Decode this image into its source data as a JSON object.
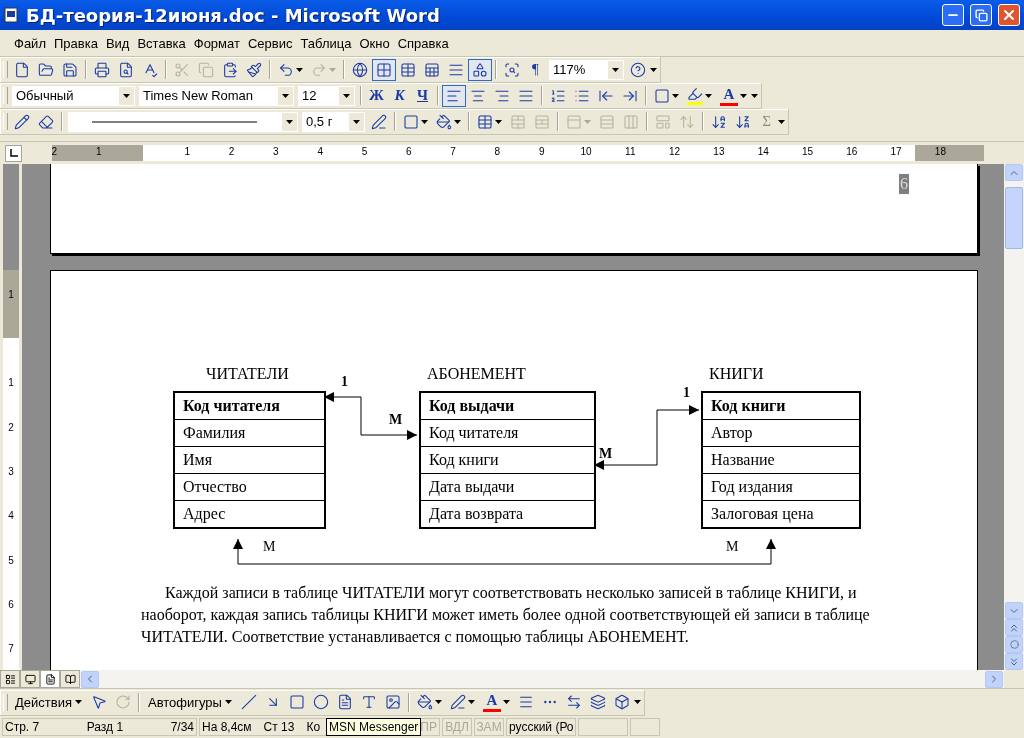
{
  "window": {
    "title": "БД-теория-12июня.doc - Microsoft Word"
  },
  "menu": [
    "Файл",
    "Правка",
    "Вид",
    "Вставка",
    "Формат",
    "Сервис",
    "Таблица",
    "Окно",
    "Справка"
  ],
  "standard_toolbar": [
    {
      "kind": "icon",
      "disabled": false,
      "pressed": false,
      "menu": false
    },
    {
      "kind": "icon",
      "disabled": false,
      "pressed": false,
      "menu": false
    },
    {
      "kind": "icon",
      "disabled": false,
      "pressed": false,
      "menu": false
    },
    {
      "kind": "separator"
    },
    {
      "kind": "icon",
      "disabled": false,
      "pressed": false,
      "menu": false
    },
    {
      "kind": "icon",
      "disabled": false,
      "pressed": false,
      "menu": false
    },
    {
      "kind": "icon",
      "disabled": false,
      "pressed": false,
      "menu": false
    },
    {
      "kind": "separator"
    },
    {
      "kind": "icon",
      "disabled": true,
      "pressed": false,
      "menu": false
    },
    {
      "kind": "icon",
      "disabled": true,
      "pressed": false,
      "menu": false
    },
    {
      "kind": "icon",
      "disabled": false,
      "pressed": false,
      "menu": false
    },
    {
      "kind": "icon",
      "disabled": false,
      "pressed": false,
      "menu": false
    },
    {
      "kind": "separator"
    },
    {
      "kind": "icon",
      "disabled": false,
      "pressed": false,
      "menu": true
    },
    {
      "kind": "icon",
      "disabled": true,
      "pressed": false,
      "menu": true
    },
    {
      "kind": "separator"
    },
    {
      "kind": "icon",
      "disabled": false,
      "pressed": false,
      "menu": false
    },
    {
      "kind": "icon",
      "disabled": false,
      "pressed": true,
      "menu": false
    },
    {
      "kind": "icon",
      "disabled": false,
      "pressed": false,
      "menu": false
    },
    {
      "kind": "icon",
      "disabled": false,
      "pressed": false,
      "menu": false
    },
    {
      "kind": "icon",
      "disabled": false,
      "pressed": false,
      "menu": false
    },
    {
      "kind": "icon",
      "disabled": false,
      "pressed": true,
      "menu": false
    },
    {
      "kind": "separator"
    },
    {
      "kind": "icon",
      "disabled": false,
      "pressed": false,
      "menu": false
    },
    {
      "kind": "text",
      "label": "¶",
      "disabled": false,
      "pressed": false,
      "menu": false
    },
    {
      "kind": "combo",
      "value": "117%"
    },
    {
      "kind": "icon",
      "disabled": false,
      "pressed": false,
      "menu": false
    },
    {
      "kind": "overflow"
    }
  ],
  "formatting_toolbar": [
    {
      "kind": "combo",
      "value": "Обычный"
    },
    {
      "kind": "combo",
      "value": "Times New Roman"
    },
    {
      "kind": "combo",
      "value": "12"
    },
    {
      "kind": "separator"
    },
    {
      "kind": "text",
      "label": "Ж",
      "disabled": false,
      "pressed": false,
      "menu": false
    },
    {
      "kind": "text",
      "label": "К",
      "disabled": false,
      "pressed": false,
      "menu": false
    },
    {
      "kind": "text",
      "label": "Ч",
      "disabled": false,
      "pressed": false,
      "menu": false
    },
    {
      "kind": "separator"
    },
    {
      "kind": "icon",
      "disabled": false,
      "pressed": true,
      "menu": false
    },
    {
      "kind": "icon",
      "disabled": false,
      "pressed": false,
      "menu": false
    },
    {
      "kind": "icon",
      "disabled": false,
      "pressed": false,
      "menu": false
    },
    {
      "kind": "icon",
      "disabled": false,
      "pressed": false,
      "menu": false
    },
    {
      "kind": "separator"
    },
    {
      "kind": "icon",
      "disabled": false,
      "pressed": false,
      "menu": false
    },
    {
      "kind": "icon",
      "disabled": false,
      "pressed": false,
      "menu": false
    },
    {
      "kind": "icon",
      "disabled": false,
      "pressed": false,
      "menu": false
    },
    {
      "kind": "icon",
      "disabled": false,
      "pressed": false,
      "menu": false
    },
    {
      "kind": "separator"
    },
    {
      "kind": "icon",
      "disabled": false,
      "pressed": false,
      "menu": true
    },
    {
      "kind": "highlight",
      "disabled": false,
      "pressed": false,
      "menu": true
    },
    {
      "kind": "font_color",
      "label": "A",
      "disabled": false,
      "pressed": false,
      "menu": true
    },
    {
      "kind": "overflow"
    }
  ],
  "tables_toolbar": [
    {
      "kind": "icon",
      "disabled": false,
      "pressed": false,
      "menu": false
    },
    {
      "kind": "icon",
      "disabled": false,
      "pressed": false,
      "menu": false
    },
    {
      "kind": "separator"
    },
    {
      "kind": "line_combo"
    },
    {
      "kind": "combo",
      "value": "0,5 г"
    },
    {
      "kind": "icon",
      "disabled": false,
      "pressed": false,
      "menu": false
    },
    {
      "kind": "separator"
    },
    {
      "kind": "icon",
      "disabled": false,
      "pressed": false,
      "menu": true
    },
    {
      "kind": "icon",
      "disabled": false,
      "pressed": false,
      "menu": true
    },
    {
      "kind": "separator"
    },
    {
      "kind": "icon",
      "disabled": false,
      "pressed": false,
      "menu": true
    },
    {
      "kind": "icon",
      "disabled": true,
      "pressed": false,
      "menu": false
    },
    {
      "kind": "icon",
      "disabled": true,
      "pressed": false,
      "menu": false
    },
    {
      "kind": "separator"
    },
    {
      "kind": "icon",
      "disabled": true,
      "pressed": false,
      "menu": true
    },
    {
      "kind": "icon",
      "disabled": true,
      "pressed": false,
      "menu": false
    },
    {
      "kind": "icon",
      "disabled": true,
      "pressed": false,
      "menu": false
    },
    {
      "kind": "separator"
    },
    {
      "kind": "icon",
      "disabled": true,
      "pressed": false,
      "menu": false
    },
    {
      "kind": "icon",
      "disabled": true,
      "pressed": false,
      "menu": false
    },
    {
      "kind": "separator"
    },
    {
      "kind": "icon",
      "disabled": false,
      "pressed": false,
      "menu": false
    },
    {
      "kind": "icon",
      "disabled": false,
      "pressed": false,
      "menu": false
    },
    {
      "kind": "text",
      "label": "Σ",
      "disabled": true,
      "pressed": false,
      "menu": false
    },
    {
      "kind": "overflow"
    }
  ],
  "ruler": {
    "labels": [
      "2",
      "1",
      "1",
      "2",
      "3",
      "4",
      "5",
      "6",
      "7",
      "8",
      "9",
      "10",
      "11",
      "12",
      "13",
      "14",
      "15",
      "16",
      "17",
      "18"
    ]
  },
  "vertical_ruler": {
    "labels": [
      "1",
      "1",
      "2",
      "3",
      "4",
      "5",
      "6",
      "7"
    ]
  },
  "document": {
    "page_number": "6",
    "diagram": {
      "tables": [
        {
          "title": "ЧИТАТЕЛИ",
          "fields": [
            {
              "name": "Код читателя",
              "key": true
            },
            {
              "name": "Фамилия",
              "key": false
            },
            {
              "name": "Имя",
              "key": false
            },
            {
              "name": "Отчество",
              "key": false
            },
            {
              "name": "Адрес",
              "key": false
            }
          ]
        },
        {
          "title": "АБОНЕМЕНТ",
          "fields": [
            {
              "name": "Код выдачи",
              "key": true
            },
            {
              "name": "Код читателя",
              "key": false
            },
            {
              "name": "Код книги",
              "key": false
            },
            {
              "name": "Дата выдачи",
              "key": false
            },
            {
              "name": "Дата возврата",
              "key": false
            }
          ]
        },
        {
          "title": "КНИГИ",
          "fields": [
            {
              "name": "Код книги",
              "key": true
            },
            {
              "name": "Автор",
              "key": false
            },
            {
              "name": "Название",
              "key": false
            },
            {
              "name": "Год издания",
              "key": false
            },
            {
              "name": "Залоговая цена",
              "key": false
            }
          ]
        }
      ],
      "links": [
        {
          "from_label": "1",
          "to_label": "М"
        },
        {
          "from_label": "М",
          "to_label": "1"
        },
        {
          "from_label": "М",
          "to_label": "М"
        }
      ]
    },
    "paragraph": "Каждой записи в таблице ЧИТАТЕЛИ могут соответствовать несколько записей в таблице КНИГИ, и наоборот, каждая запись таблицы КНИГИ может иметь более одной соответствующей ей записи в таблице ЧИТАТЕЛИ. Соответствие устанавливается с помощью таблицы АБОНЕМЕНТ."
  },
  "drawing_toolbar": [
    {
      "kind": "text",
      "label": "Действия",
      "disabled": false,
      "pressed": false,
      "menu": true
    },
    {
      "kind": "icon",
      "disabled": false,
      "pressed": false,
      "menu": false
    },
    {
      "kind": "icon",
      "disabled": true,
      "pressed": false,
      "menu": false
    },
    {
      "kind": "separator"
    },
    {
      "kind": "text",
      "label": "Автофигуры",
      "disabled": false,
      "pressed": false,
      "menu": true
    },
    {
      "kind": "icon",
      "disabled": false,
      "pressed": false,
      "menu": false
    },
    {
      "kind": "icon",
      "disabled": false,
      "pressed": false,
      "menu": false
    },
    {
      "kind": "icon",
      "disabled": false,
      "pressed": false,
      "menu": false
    },
    {
      "kind": "icon",
      "disabled": false,
      "pressed": false,
      "menu": false
    },
    {
      "kind": "icon",
      "disabled": false,
      "pressed": false,
      "menu": false
    },
    {
      "kind": "icon",
      "disabled": false,
      "pressed": false,
      "menu": false
    },
    {
      "kind": "icon",
      "disabled": false,
      "pressed": false,
      "menu": false
    },
    {
      "kind": "separator"
    },
    {
      "kind": "icon",
      "disabled": false,
      "pressed": false,
      "menu": true
    },
    {
      "kind": "icon",
      "disabled": false,
      "pressed": false,
      "menu": true
    },
    {
      "kind": "font_color",
      "label": "A",
      "disabled": false,
      "pressed": false,
      "menu": true
    },
    {
      "kind": "icon",
      "disabled": false,
      "pressed": false,
      "menu": false
    },
    {
      "kind": "icon",
      "disabled": false,
      "pressed": false,
      "menu": false
    },
    {
      "kind": "icon",
      "disabled": false,
      "pressed": false,
      "menu": false
    },
    {
      "kind": "icon",
      "disabled": false,
      "pressed": false,
      "menu": false
    },
    {
      "kind": "icon",
      "disabled": false,
      "pressed": false,
      "menu": false
    },
    {
      "kind": "overflow"
    }
  ],
  "status_bar": [
    {
      "text": "Стр. 7",
      "disabled": false
    },
    {
      "text": "Разд 1",
      "disabled": false
    },
    {
      "text": "7/34",
      "disabled": false
    },
    {
      "text": "На 8,4см",
      "disabled": false
    },
    {
      "text": "Ст 13",
      "disabled": false
    },
    {
      "text": "Ко",
      "disabled": false
    },
    {
      "text": "ПР",
      "disabled": true
    },
    {
      "text": "ВДЛ",
      "disabled": true
    },
    {
      "text": "ЗАМ",
      "disabled": true
    },
    {
      "text": "русский (Ро",
      "disabled": false
    }
  ],
  "tooltip": "MSN Messenger"
}
